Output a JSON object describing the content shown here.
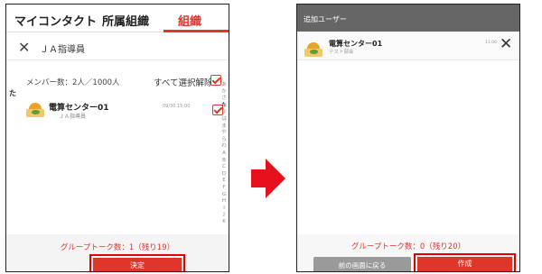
{
  "left_screen": {
    "tabs": [
      {
        "label": "マイコンタクト"
      },
      {
        "label": "所属組織"
      },
      {
        "label": "組織"
      }
    ],
    "active_tab": 2,
    "search": {
      "close_icon": "✕",
      "text": "ＪＡ指導員"
    },
    "member_count": "メンバー数：2人／1000人",
    "deselect_all": "すべて選択解除",
    "section_header": "た",
    "item": {
      "name": "電算センター01",
      "sub": "ＪＡ指導員",
      "time": "09/30 15:00"
    },
    "index_letters": [
      "あ",
      "か",
      "さ",
      "た",
      "な",
      "は",
      "ま",
      "や",
      "ら",
      "わ",
      "A",
      "B",
      "C",
      "D",
      "E",
      "F",
      "G",
      "H",
      "I",
      "J",
      "K"
    ],
    "active_index": 3,
    "group_talk_count": "グループトーク数：1（残り19）",
    "decide_button": "決定"
  },
  "right_screen": {
    "header_title": "追加ユーザー",
    "item": {
      "name": "電算センター01",
      "sub": "テスト部会",
      "time": "11:06"
    },
    "remove_icon": "✕",
    "group_talk_count": "グループトーク数：0（残り20）",
    "back_button": "前の画面に戻る",
    "create_button": "作成"
  },
  "colors": {
    "accent": "#e0352b",
    "highlight_box": "#e00000",
    "header_gray": "#666666",
    "back_button_gray": "#9a9a9a"
  }
}
